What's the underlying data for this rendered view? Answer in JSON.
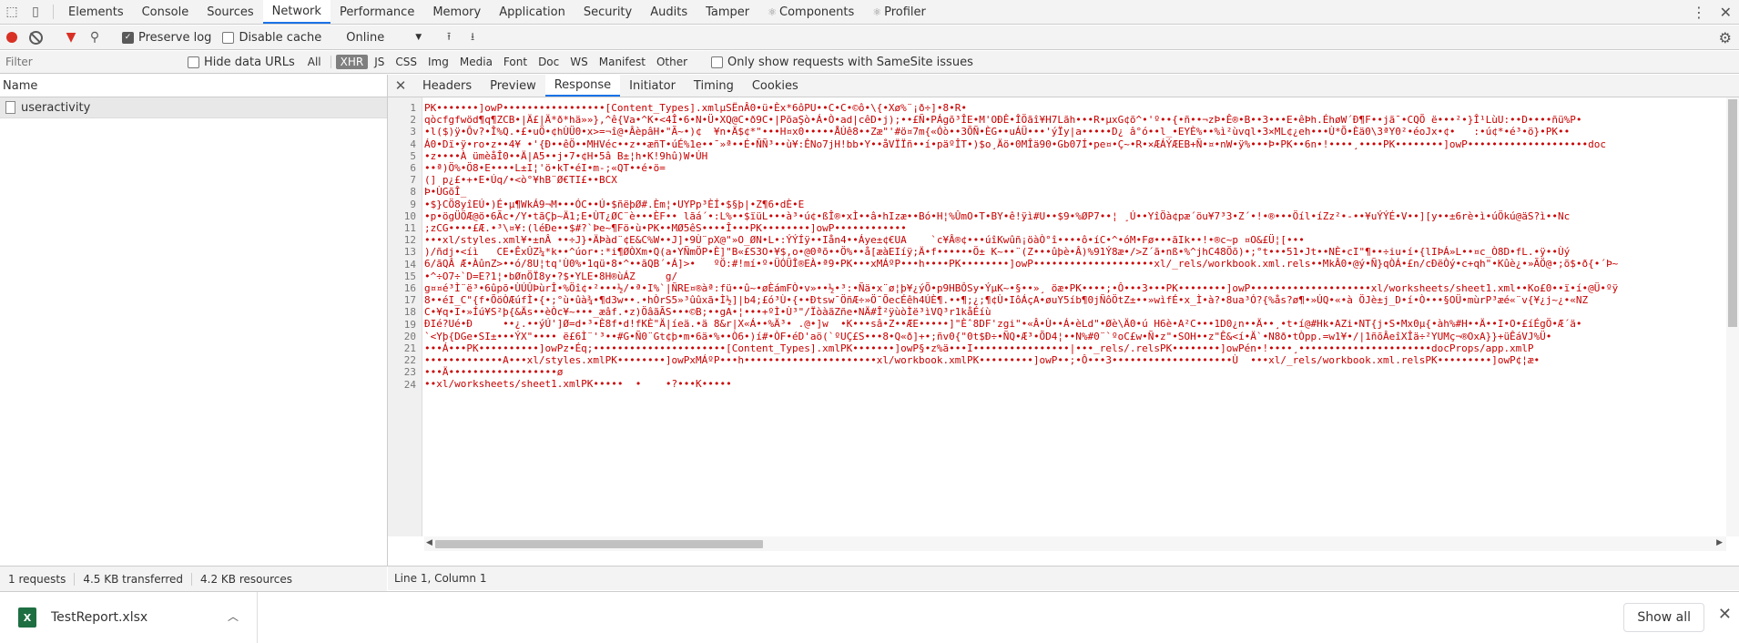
{
  "tabs": [
    {
      "label": "Elements"
    },
    {
      "label": "Console"
    },
    {
      "label": "Sources"
    },
    {
      "label": "Network",
      "active": true
    },
    {
      "label": "Performance"
    },
    {
      "label": "Memory"
    },
    {
      "label": "Application"
    },
    {
      "label": "Security"
    },
    {
      "label": "Audits"
    },
    {
      "label": "Tamper"
    },
    {
      "label": "Components",
      "icon": "⚛"
    },
    {
      "label": "Profiler",
      "icon": "⚛"
    }
  ],
  "toolbar": {
    "preserve_log": "Preserve log",
    "disable_cache": "Disable cache",
    "throttle": "Online"
  },
  "filter": {
    "placeholder": "Filter",
    "hide_data_urls": "Hide data URLs",
    "types": [
      "All",
      "XHR",
      "JS",
      "CSS",
      "Img",
      "Media",
      "Font",
      "Doc",
      "WS",
      "Manifest",
      "Other"
    ],
    "active_type": "XHR",
    "same_site": "Only show requests with SameSite issues"
  },
  "list": {
    "header": "Name",
    "rows": [
      "useractivity"
    ]
  },
  "status": {
    "requests": "1 requests",
    "transferred": "4.5 KB transferred",
    "resources": "4.2 KB resources"
  },
  "detail": {
    "tabs": [
      "Headers",
      "Preview",
      "Response",
      "Initiator",
      "Timing",
      "Cookies"
    ],
    "active_tab": "Response",
    "position": "Line 1, Column 1",
    "lines": [
      "PK•••••••]owP•••••••••••••••••[Content_Types].xmlµSËnÂ0•ü•Èx*6ôPU••C•C•©ô•\\{•Xø%¨¡ð÷]•8•R•",
      "qòcfgfwöd¶q¶ZCB•|Ä£|Ä*ð*hä»»},^ê{Va•^K•<4Î•6•N•Ü•XQ@C•ð9C•|PõaŞò•Á•Ò•ad|cêD•j);••£Ñ•PÁgõ³ÎE•M'OÐÊ•ÎÖãî¥H7Lãh•••R•µxG¢õ^•'º••{•ñ••¬zÞ•Ê®•B••3•••E•êÞh.ÉhøW´Ð¶F••jã¯•CQÕ ë•••²•}Î¹LùU:••D••••ñü%P•",
      "•l($)ÿ•Ôv?•Î%Q.•£•uÖ•¢hÙÜ0•x>=¬î@•ÂèpâH•\"Ã~•)¢  ¥n•Ä$¢*\"•••H¤x0•••••ÅÚê8••Zæ\"'#ö¤7m{«Óò••3ÕÑ•ÈG••uÁÜ•••'ýÏy|a•••••D¿ â°ó••l_•EYÈ%••%ì²ùvql•3×ML¢¿eh•••Ù*Õ•Èä0\\3ªY0²•éoJx•¢•   :•ú¢*•é³•ö}•PK••",
      "Á0•Dï•ÿ•ro•z••4¥ •'{Ð••êÖ••MHVéc••z••æñT•úÉ%1e••¯»ª••É•ÑÑ³••ù¥:ÊNo7jH!bb•Y••åVÏÏñ••í•päºÎT•)$o¸Äö•0MÎä90•Gb07Í•pe¤•Ç~•R•×ÆÁÝÆEB+Ñ•¤•nW•ÿ%•••Þ•PK••6n•!••••¸••••PK••••••••]owP••••••••••••••••••••doc",
      "•z••••À ümèåÎ0••Ä|A5••j•7•¢H•5â B±¦h•K!9hû)W•ÚH",
      "••ª)Ö%•Ö8•E••••L±I¦'ö•kT•éI•m-;«QT••é•ö=",
      "(] p¿£•+•E•Úq/•<ò°¥hB¨Ø€TI£••BCX",
      "Þ•ÙGõÎ_",
      "•$}CÖ8yîEÚ•)É•µ¶WkÁ9¬M•••ÓC••Ú•$ñëþØ#.Èm¦•UYPp³ÈÍ•$§þ|•Z¶6•dÈ•E",
      "•p•ögÜÖÆ@ö•6Ãc•/Y•tãÇþ~Ä1;E•ÙT¿ØC¨è•••ÈF•• lãá´•:L%••$ïüL•••à³•ú¢•ßÎ®•xÌ••â•hIzæ••Bó•H¦%ÛmO•T•BY•ê!ÿì#U••$9•%ØP7••¦ ¸Ú••YîÖà¢pæ´öu¥7³3•Z´•!•®•••Öíl•íZz²•-••¥uÝÝÉ•V••][y••±6rè•ì•úÖkú@äS?ì••Nc",
      ";zCG••••£Æ.•³\\¤¥:(léÐe••$#?`Þe~¶Fö•ù•PK••MØ5êS••••Î•••PK••••••••]owP••••••••••••",
      "•••xl/styles.xml¥•±nÂ ••÷J}•ÄÞàd¨¢E&C%W••J]•9Ù¨pX@\"»O_ØN•L•:ÝÝÍÿ••Iån4••Áye±¢€UA    `c¥Â®¢•••úîKwûñ¡öàÒ°î••••ô•íC•^•óM•Fø•••ãIk••!•®c~p ¤O&£Ü¦[•••",
      ")/ñdj•<íì   CE•ÊxÛZ¼*k••^úor•:*i¶ØÒXm•Q(a•YÑmÖP•È]\"B«£S3O•¥$,o•@0ªõ••Ö%••å[æàEIíÿ;Ä•f••••••Ö± K~••¨(Z•••ûþè•Â)%91Ý8æ•/>Z´ã•nß•%^jhC48Öõ)•;°t•••51•Jt••NÈ•cI\"¶••÷iu•í•{lIÞÁ»L••¤c_Ò8D•fL.•ÿ••Ùý",
      "6/ãQÂ Æ•ÀûnZ>••ó/8U¦tq'Ù0%•1qü•8•^••ãQB´•Á]>•   ºÖ:#!mí•º•ÜÓÜÎ®EÀ•ª9•PK•••xMÁºP•••h••••PK••••••••]owP••••••••••••••••••••xl/_rels/workbook.xml.rels••MkÂ0•@ý•Ñ}qÒÁ•£n/cÐëÒý•c+qh\"•Kûè¿•»ÃÖ@•;õ$•ð{•´Þ~",
      "•^÷O7÷`D=E?1¦•bØnÖÏ8y•?$•YLE•8H®ùÁZ     g/",
      "g¤¤é³Ì¨ë³•6ûpõ•ÙÚÛÞùrÎ•%Öî¢•²•••½/•ª•I%`|ÑRE¤®àª:fü••û~•øÈámFÒ•v»••½•³:•Ñä•x¨ø¦þ¥¿ýÕ•p9HBÔSy•ÝµK~•§••»¸ öæ•PK••••;•Ô•••3•••PK••••••••]owP••••••••••••••••••••xl/worksheets/sheet1.xml••Ko£0••ï•í•@Ü•ºÿ",
      "8••éI_C\"{f•ÕöÒÆúfÌ•{•;°ù•ûà¾•¶d3w••.•hÒrS5»³ûûxã•Ì½]|b4;£ó³Ù•{••Ðtsw¯ÖñÆ÷»Ö¯ÕecÉêh4ÚÈ¶.••¶;¿;¶¢Ù•IôÁçA•øuY5íb¶0jÑôÖtZ±••»wìfÉ•x_Ì•à?•8ua³Ó?{%ås?ø¶•»ÚQ•«•à ÖJè±j_D•í•Ò•••§OÜ•mùrP³æé«¨v{¥¿j~¿•«NZ",
      "C•¥q•I•»Íú¥S²þ{&Äs••èÒc¥~•••_æâf.•z)ÖâãÃS•••©B;••gA•¦•••+ºÌ•Ù³\"/Ïòà­ãZñe•NÄ#Î²ÿùòÌë³ìVQ³r1kåÉíù",
      "ÐIé?Ué•Ð     ••¿.••ýÚ']Ø=d•³•È8f•d!fKÈ\"Ä|íeä.•ä 8&r|X«Á••%Ä³• .@•]w  •K•••sâ•Z••ÆE•••••]\"Èˆ8DF'zgi\"•«Â•Ù••Á•èLd\"•Øè\\Ä0•ú H6è•A²C•••1D0¿n••Ä••¸•t•í@#Hk•AZi•NT{j•S•Mx0µ{•àh%#H••Ä••I•O•£íÉgÖ•Æ´ä•",
      "`<Yþ{DGe•SI±•••ÝX\"•••• ë£6Ì¨'³••#G•Ñ0¨Gt¢þ•m•6ä•%••Ò6•)í#•ÒF•éD'aö(`ºUÇ£S•••8•Q«ð]+•;ñv0{\"0t$Ð÷•ÑQ•Æ³•ÕD4¦••N%#0¨`ºoC£w•Ñ•z\"•SOH••z\"Ê&<í•Ä`•N8ð•tÒpp.=w1¥•/|1ñõÂeîXÎä÷²YUMç¬®OxA}}+üÊáVJ%Ü•",
      "•••Á•••PK••••••••••]owPz•Éq;••••••••••••••••••••••[Content_Types].xmlPK•••••••]owP§•z%ä•••I••••••••••••••••|•••_rels/.relsPK••••••••]owPén•!••••¸••••••••••••••••••••••docProps/app.xmlP",
      "•••••••••••••A•••xl/styles.xmlPK••••••••]owPxMÁºP•••h••••••••••••••••••••••xl/workbook.xmlPK•••••••••]owP••;•Ô•••3••••••••••••••••••••Ù  •••xl/_rels/workbook.xml.relsPK•••••••••]owP¢¦æ•",
      "•••Ä••••••••••••••••••ø",
      "••xl/worksheets/sheet1.xmlPK•••••  •    •?•••K•••••"
    ]
  },
  "download": {
    "filename": "TestReport.xlsx",
    "show_all": "Show all"
  }
}
